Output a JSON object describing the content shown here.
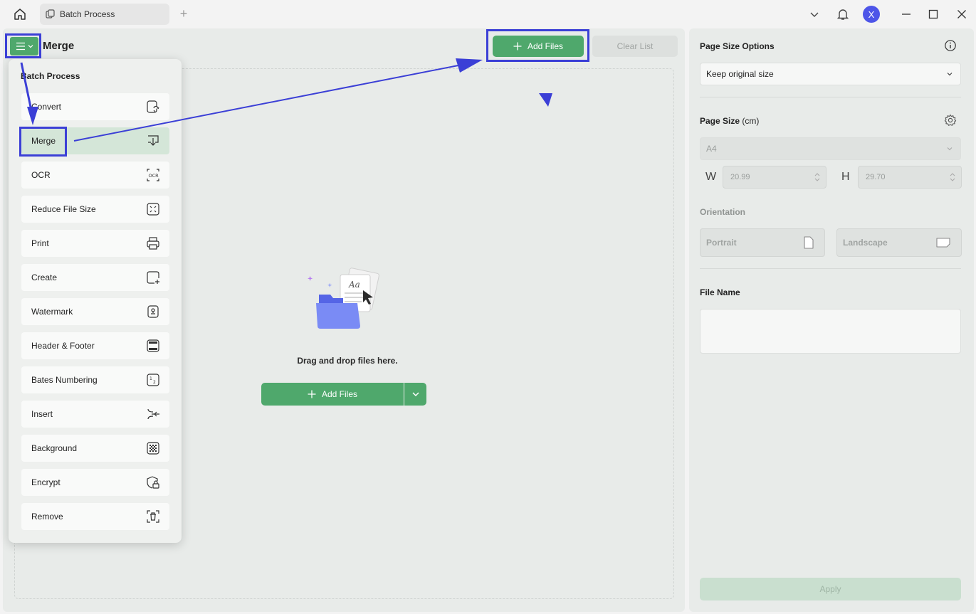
{
  "titlebar": {
    "tab_label": "Batch Process",
    "avatar_initial": "X"
  },
  "main": {
    "title": "Merge",
    "add_files_label": "Add Files",
    "clear_list_label": "Clear List",
    "drop_text": "Drag and drop files here.",
    "add_files_main_label": "Add Files"
  },
  "menu": {
    "heading": "Batch Process",
    "items": [
      {
        "label": "Convert",
        "icon": "convert-icon"
      },
      {
        "label": "Merge",
        "icon": "merge-icon",
        "active": true
      },
      {
        "label": "OCR",
        "icon": "ocr-icon"
      },
      {
        "label": "Reduce File Size",
        "icon": "reduce-size-icon"
      },
      {
        "label": "Print",
        "icon": "printer-icon"
      },
      {
        "label": "Create",
        "icon": "create-icon"
      },
      {
        "label": "Watermark",
        "icon": "watermark-icon"
      },
      {
        "label": "Header & Footer",
        "icon": "header-footer-icon"
      },
      {
        "label": "Bates Numbering",
        "icon": "bates-icon"
      },
      {
        "label": "Insert",
        "icon": "insert-icon"
      },
      {
        "label": "Background",
        "icon": "background-icon"
      },
      {
        "label": "Encrypt",
        "icon": "encrypt-icon"
      },
      {
        "label": "Remove",
        "icon": "remove-icon"
      }
    ]
  },
  "side": {
    "page_size_options_label": "Page Size Options",
    "page_size_option_value": "Keep original size",
    "page_size_label": "Page Size",
    "page_size_unit": "(cm)",
    "paper_value": "A4",
    "width_letter": "W",
    "width_value": "20.99",
    "height_letter": "H",
    "height_value": "29.70",
    "orientation_label": "Orientation",
    "portrait_label": "Portrait",
    "landscape_label": "Landscape",
    "file_name_label": "File Name",
    "apply_label": "Apply"
  },
  "colors": {
    "accent_green": "#4fa86c",
    "annotation_blue": "#3b3fd6"
  }
}
